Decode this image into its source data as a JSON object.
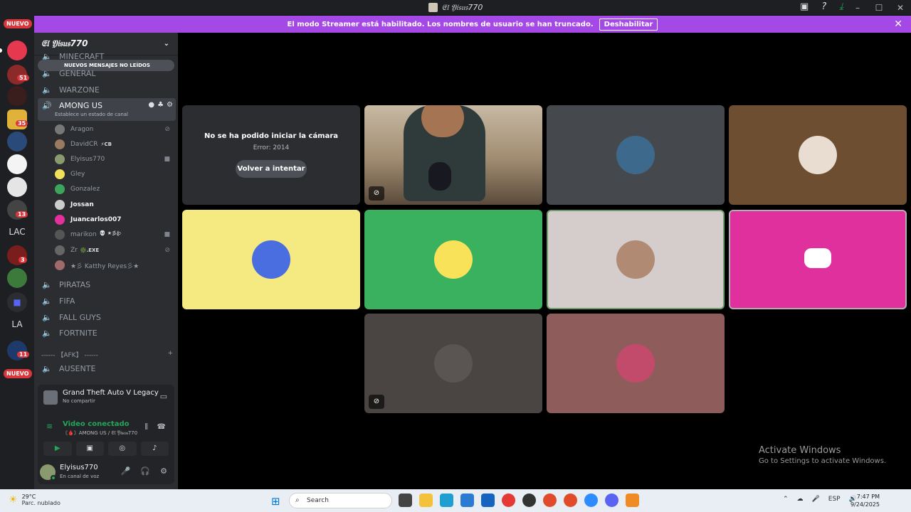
{
  "window": {
    "title": "𝔈𝔩 𝔜𝔦𝔰𝔲𝔰770",
    "controls": [
      "–",
      "☐",
      "✕"
    ]
  },
  "banner": {
    "text": "El modo Streamer está habilitado. Los nombres de usuario se han truncado.",
    "button": "Deshabilitar"
  },
  "guilds": {
    "badge_new": "NUEVO",
    "lac": "LAC",
    "la": "LA",
    "counts": [
      "51",
      "35",
      "13",
      "3",
      "11"
    ]
  },
  "server": {
    "name": "𝔈𝔩 𝔜𝔦𝔰𝔲𝔰770",
    "unread_banner": "NUEVOS MENSAJES NO LEÍDOS"
  },
  "channels": {
    "minecraft": "MINECRAFT",
    "general": "GENERAL",
    "warzone": "WARZONE",
    "among_us": "AMONG US",
    "among_us_status": "Establece un estado de canal",
    "piratas": "PIRATAS",
    "fifa": "FIFA",
    "fall_guys": "FALL GUYS",
    "fortnite": "FORTNITE",
    "afk_category": "------ 【AFK】 ------",
    "ausente": "AUSENTE"
  },
  "voice_users": [
    {
      "name": "Aragon",
      "tag": ""
    },
    {
      "name": "DavidCR",
      "tag": "⚡CB"
    },
    {
      "name": "Elyisus770",
      "tag": ""
    },
    {
      "name": "Gley",
      "tag": ""
    },
    {
      "name": "Gonzalez",
      "tag": ""
    },
    {
      "name": "Jossan",
      "tag": ""
    },
    {
      "name": "Juancarlos007",
      "tag": ""
    },
    {
      "name": "marikon",
      "tag": "💀 ★彡ꦿ"
    },
    {
      "name": "Zr",
      "tag": "❇️.EXE"
    },
    {
      "name": "★彡 Katthy Reyes彡★",
      "tag": ""
    }
  ],
  "activity": {
    "game": "Grand Theft Auto V Legacy",
    "sub": "No compartir"
  },
  "voice": {
    "status": "Video conectado",
    "location": "〘🩸〙AMONG US / 𝔈𝔩 𝔜𝔦𝔰𝔲𝔰770"
  },
  "me": {
    "name": "Elyisus770",
    "status": "En canal de voz"
  },
  "stage": {
    "error_title": "No se ha podido iniciar la cámara",
    "error_code": "Error: 2014",
    "retry": "Volver a intentar"
  },
  "activate": {
    "title": "Activate Windows",
    "sub": "Go to Settings to activate Windows."
  },
  "taskbar": {
    "temp": "29°C",
    "weather": "Parc. nublado",
    "search": "Search",
    "lang": "ESP",
    "time": "7:47 PM",
    "date": "9/24/2025"
  }
}
